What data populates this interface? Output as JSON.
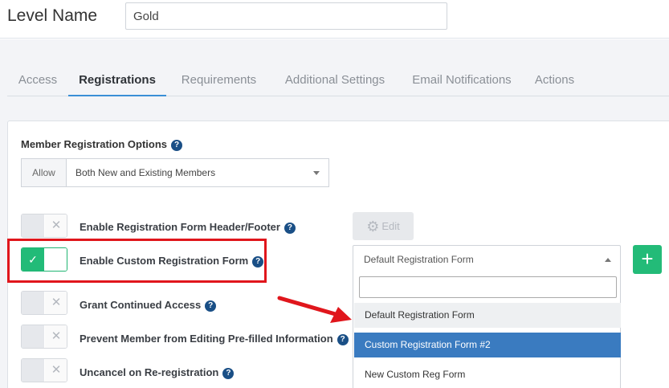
{
  "header": {
    "level_label": "Level Name",
    "level_value": "Gold"
  },
  "tabs": [
    {
      "label": "Access"
    },
    {
      "label": "Registrations"
    },
    {
      "label": "Requirements"
    },
    {
      "label": "Additional Settings"
    },
    {
      "label": "Email Notifications"
    },
    {
      "label": "Actions"
    }
  ],
  "active_tab": "Registrations",
  "section": {
    "title": "Member Registration Options",
    "allow_prefix": "Allow",
    "allow_value": "Both New and Existing Members"
  },
  "options": [
    {
      "label": "Enable Registration Form Header/Footer",
      "enabled": false
    },
    {
      "label": "Enable Custom Registration Form",
      "enabled": true
    },
    {
      "label": "Grant Continued Access",
      "enabled": false
    },
    {
      "label": "Prevent Member from Editing Pre-filled Information",
      "enabled": false
    },
    {
      "label": "Uncancel on Re-registration",
      "enabled": false
    }
  ],
  "edit_button": {
    "label": "Edit"
  },
  "form_select": {
    "value": "Default Registration Form",
    "search_value": "",
    "options": [
      {
        "label": "Default Registration Form",
        "state": "hover"
      },
      {
        "label": "Custom Registration Form #2",
        "state": "selected"
      },
      {
        "label": "New Custom Reg Form",
        "state": "normal"
      }
    ]
  },
  "icons": {
    "help": "question-circle-icon",
    "gear": "gear-icon",
    "plus": "plus-icon",
    "check": "check-icon",
    "x": "x-icon"
  },
  "colors": {
    "accent_blue": "#3a8fd6",
    "toggle_green": "#22bb78",
    "highlight_red": "#e0161c",
    "selected_blue": "#3a7bc0",
    "help_navy": "#1a4f86"
  }
}
